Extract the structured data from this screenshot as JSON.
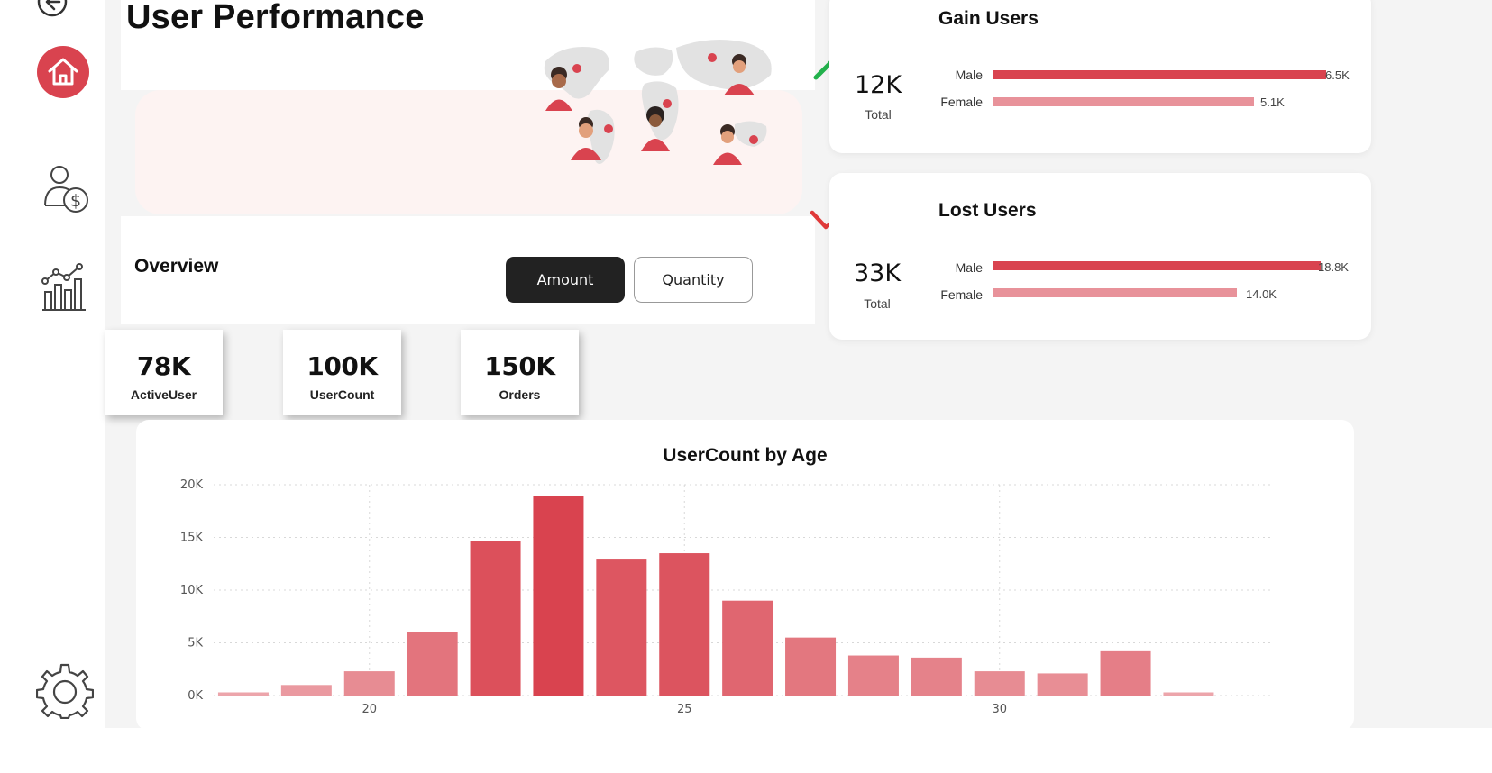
{
  "page": {
    "title": "User Performance"
  },
  "overview": {
    "label": "Overview",
    "buttons": {
      "amount": "Amount",
      "quantity": "Quantity"
    }
  },
  "kpis": [
    {
      "value": "78K",
      "label": "ActiveUser"
    },
    {
      "value": "100K",
      "label": "UserCount"
    },
    {
      "value": "150K",
      "label": "Orders"
    }
  ],
  "gain_users": {
    "title": "Gain Users",
    "total": "12K",
    "total_label": "Total",
    "trend_color": "#22b14c",
    "rows": [
      {
        "label": "Male",
        "value_text": "6.5K",
        "value": 6.5,
        "color": "#d9434f"
      },
      {
        "label": "Female",
        "value_text": "5.1K",
        "value": 5.1,
        "color": "#e8929a"
      }
    ]
  },
  "lost_users": {
    "title": "Lost Users",
    "total": "33K",
    "total_label": "Total",
    "trend_color": "#e03a3a",
    "rows": [
      {
        "label": "Male",
        "value_text": "18.8K",
        "value": 18.8,
        "color": "#d9434f"
      },
      {
        "label": "Female",
        "value_text": "14.0K",
        "value": 14.0,
        "color": "#e8929a"
      }
    ]
  },
  "sidebar": {
    "icons": [
      "back-icon",
      "home-icon",
      "user-dollar-icon",
      "analytics-chart-icon",
      "settings-gear-icon"
    ],
    "active_color": "#d9434f"
  },
  "chart_data": {
    "type": "bar",
    "title": "UserCount by Age",
    "xlabel": "",
    "ylabel": "",
    "x": [
      18,
      19,
      20,
      21,
      22,
      23,
      24,
      25,
      26,
      27,
      28,
      29,
      30,
      31,
      32,
      33
    ],
    "values": [
      300,
      1000,
      2300,
      6000,
      14700,
      18900,
      12900,
      13500,
      9000,
      5500,
      3800,
      3600,
      2300,
      2100,
      4200,
      300
    ],
    "x_ticks": [
      20,
      25,
      30
    ],
    "ylim": [
      0,
      20000
    ],
    "y_ticks": [
      0,
      5000,
      10000,
      15000,
      20000
    ],
    "y_tick_labels": [
      "0K",
      "5K",
      "10K",
      "15K",
      "20K"
    ],
    "grid": true,
    "bar_color_high": "#d9434f",
    "bar_color_low": "#efb3b8"
  }
}
